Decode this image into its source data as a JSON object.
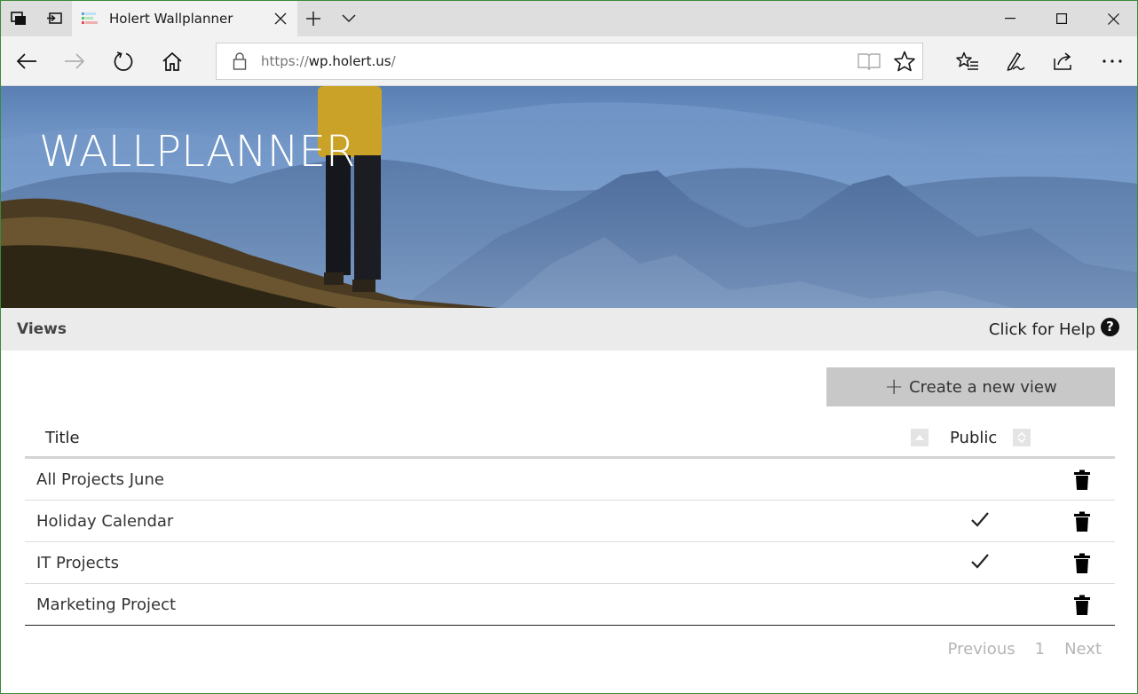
{
  "browser": {
    "tab_title": "Holert Wallplanner",
    "url_scheme": "https://",
    "url_host": "wp.holert.us",
    "url_path": "/"
  },
  "page": {
    "hero_title": "WALLPLANNER",
    "views_tab": "Views",
    "help_label": "Click for Help",
    "help_glyph": "?",
    "create_button": "Create a new view",
    "create_plus": "+",
    "table": {
      "col_title": "Title",
      "col_public": "Public",
      "rows": [
        {
          "title": "All Projects June",
          "public": false
        },
        {
          "title": "Holiday Calendar",
          "public": true
        },
        {
          "title": "IT Projects",
          "public": true
        },
        {
          "title": "Marketing Project",
          "public": false
        }
      ]
    },
    "pager": {
      "previous": "Previous",
      "page": "1",
      "next": "Next"
    }
  },
  "colors": {
    "accent_button": "#c8c8c8",
    "subbar": "#ebebeb",
    "window_border": "#3a8a3a"
  }
}
